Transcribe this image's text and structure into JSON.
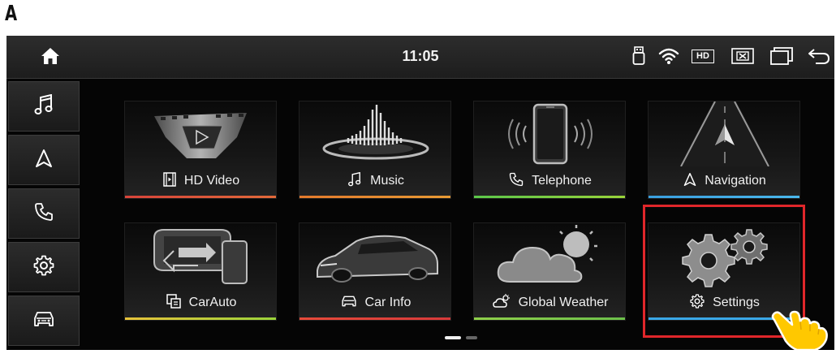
{
  "panel_label": "A",
  "status_bar": {
    "time": "11:05",
    "hd_badge": "HD",
    "icons": [
      "home-icon",
      "usb-icon",
      "wifi-icon",
      "hd-icon",
      "close-box-icon",
      "windows-icon",
      "back-icon"
    ]
  },
  "sidebar": {
    "items": [
      {
        "name": "music",
        "icon": "music-note-icon"
      },
      {
        "name": "navigation",
        "icon": "navigation-arrow-icon"
      },
      {
        "name": "phone",
        "icon": "phone-icon"
      },
      {
        "name": "settings",
        "icon": "gear-icon"
      },
      {
        "name": "car",
        "icon": "car-icon"
      }
    ]
  },
  "apps": [
    {
      "label": "HD Video",
      "icon": "film-icon",
      "accent": "#e8463c"
    },
    {
      "label": "Music",
      "icon": "music-note-icon",
      "accent": "#f0802c"
    },
    {
      "label": "Telephone",
      "icon": "phone-icon",
      "accent": "#7ad04a"
    },
    {
      "label": "Navigation",
      "icon": "navigation-arrow-icon",
      "accent": "#3aa8e8"
    },
    {
      "label": "CarAuto",
      "icon": "carauto-icon",
      "accent": "#e8c33a"
    },
    {
      "label": "Car Info",
      "icon": "car-icon",
      "accent": "#e84a3a"
    },
    {
      "label": "Global Weather",
      "icon": "weather-icon",
      "accent": "#8fd04a"
    },
    {
      "label": "Settings",
      "icon": "gear-icon",
      "accent": "#3aa8e8"
    }
  ],
  "pager": {
    "pages": 2,
    "current": 1
  },
  "colors": {
    "highlight": "#e0262a",
    "hand": "#ffc800"
  }
}
